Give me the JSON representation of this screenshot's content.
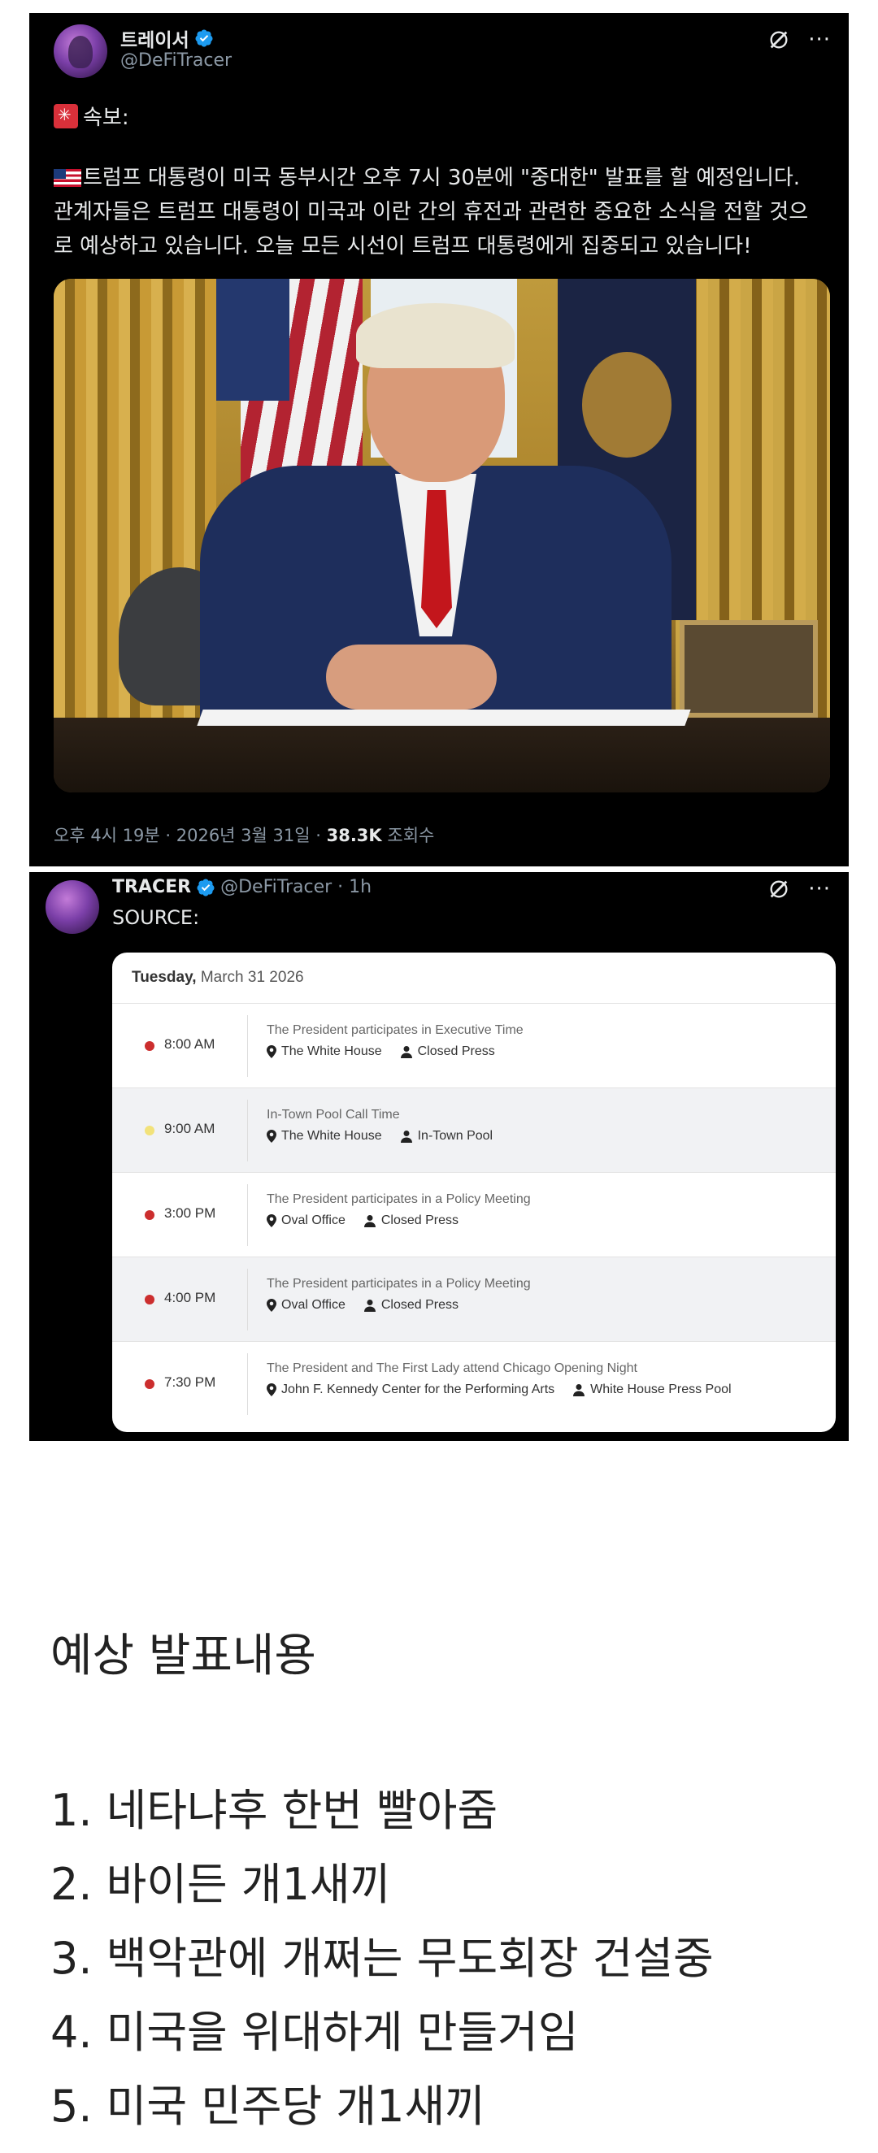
{
  "tweet1": {
    "display_name": "트레이서",
    "handle": "@DeFiTracer",
    "breaking_label": "속보:",
    "body_lines": [
      "트럼프 대통령이 미국 동부시간 오후 7시 30분에 \"중대한\" 발표를 할 예정입니다.",
      "관계자들은 트럼프 대통령이 미국과 이란 간의 휴전과 관련한 중요한 소식을 전할 것으",
      "로 예상하고 있습니다. 오늘 모든 시선이 트럼프 대통령에게 집중되고 있습니다!"
    ],
    "meta_time": "오후 4시 19분 · 2026년 3월 31일 · ",
    "meta_views": "38.3K",
    "meta_views_label": " 조회수"
  },
  "tweet2": {
    "display_name": "TRACER",
    "handle": "@DeFiTracer · 1h",
    "source_label": "SOURCE:",
    "schedule": {
      "date_bold": "Tuesday,",
      "date_rest": " March 31 2026",
      "rows": [
        {
          "dot_color": "#cc2e2e",
          "time": "8:00 AM",
          "title": "The President participates in Executive Time",
          "location": "The White House",
          "coverage": "Closed Press"
        },
        {
          "dot_color": "#f2e27a",
          "time": "9:00 AM",
          "title": "In-Town Pool Call Time",
          "location": "The White House",
          "coverage": "In-Town Pool"
        },
        {
          "dot_color": "#cc2e2e",
          "time": "3:00 PM",
          "title": "The President participates in a Policy Meeting",
          "location": "Oval Office",
          "coverage": "Closed Press"
        },
        {
          "dot_color": "#cc2e2e",
          "time": "4:00 PM",
          "title": "The President participates in a Policy Meeting",
          "location": "Oval Office",
          "coverage": "Closed Press"
        },
        {
          "dot_color": "#cc2e2e",
          "time": "7:30 PM",
          "title": "The President and The First Lady attend Chicago Opening Night",
          "location": "John F. Kennedy Center for the Performing Arts",
          "coverage": "White House Press Pool"
        }
      ]
    }
  },
  "bottom": {
    "title": "예상 발표내용",
    "items": [
      "1. 네타냐후 한번 빨아줌",
      "2. 바이든 개1새끼",
      "3. 백악관에 개쩌는 무도회장 건설중",
      "4. 미국을 위대하게 만들거임",
      "5. 미국 민주당 개1새끼"
    ]
  },
  "colors": {
    "tweet_bg": "#000000",
    "verified_blue": "#1d9bf0",
    "muted_text": "#8b98a5",
    "red_dot": "#cc2e2e",
    "yellow_dot": "#f2e27a"
  }
}
